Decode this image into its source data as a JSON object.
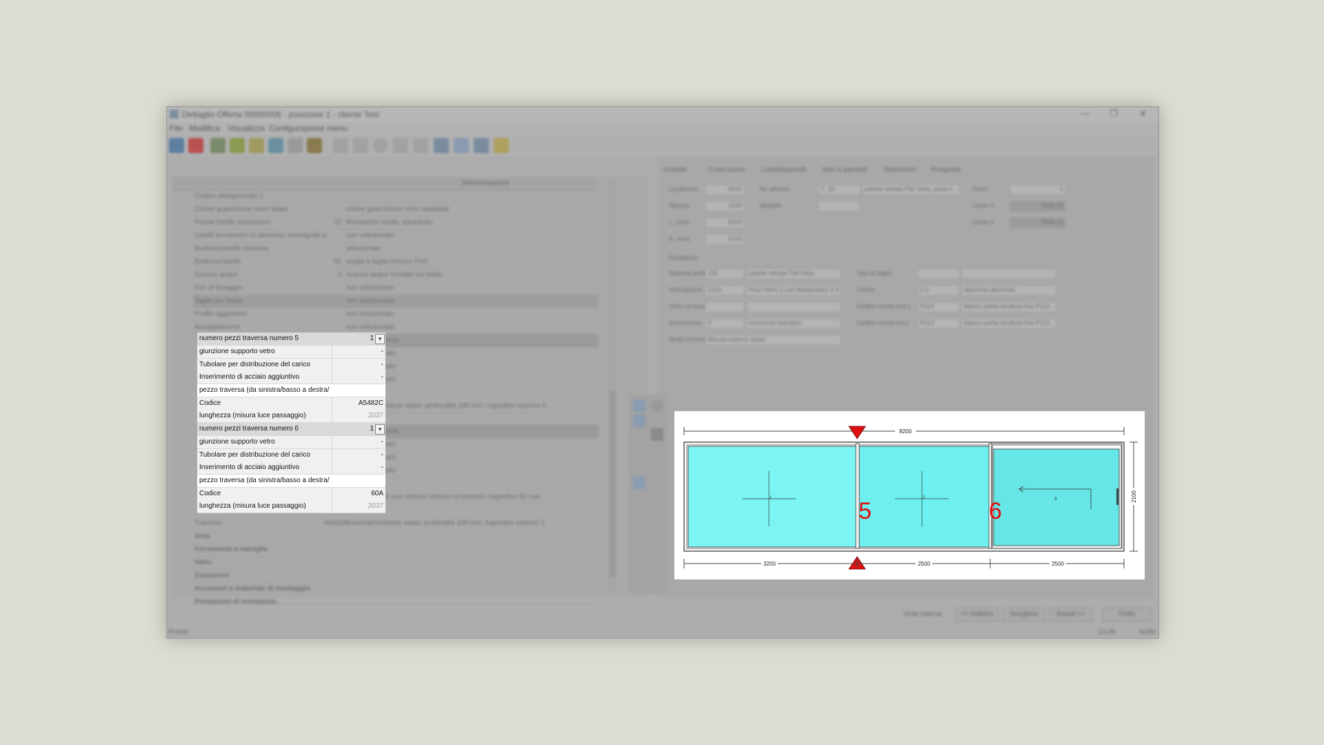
{
  "window": {
    "title": "Dettaglio Offerta 00000006 - posizione 1 - cliente Test",
    "menu": [
      "File",
      "Modifica",
      "Visualizza",
      "Configurazione menu"
    ]
  },
  "left_grid": {
    "header": "Denominazione",
    "background_rows": [
      {
        "name": "Codice allargamento 2",
        "value": "",
        "desc": ""
      },
      {
        "name": "Colore guarnizione vetro telaio",
        "value": "-",
        "desc": "colore guarnizione vetro standard"
      },
      {
        "name": "Forma listello fermavetro",
        "value": "10",
        "desc": "fermavetro tondo, squadrato"
      },
      {
        "name": "Listelli fermavetro in alluminio consegnati a",
        "value": "",
        "desc": "non selezionato"
      },
      {
        "name": "Bodenschwelle simulata",
        "value": "",
        "desc": "selezionato"
      },
      {
        "name": "Bodenschwelle",
        "value": "50",
        "desc": "soglia a taglio termico PVC"
      },
      {
        "name": "Scarico acque",
        "value": "0",
        "desc": "scarico acque frontale sul telaio"
      },
      {
        "name": "Fori di fissaggio",
        "value": "",
        "desc": "non selezionato"
      },
      {
        "name": "Taglio per telaio",
        "value": "",
        "desc": "non selezionato"
      },
      {
        "name": "Profilo aggiuntivo",
        "value": "",
        "desc": "non selezionato"
      },
      {
        "name": "Accoppiamenti",
        "value": "",
        "desc": "non selezionato"
      }
    ],
    "rows": [
      {
        "name": "numero pezzi traversa numero 5",
        "value": "1",
        "desc": "1 pezzo traversa",
        "type": "hdr",
        "dropdown": true
      },
      {
        "name": "giunzione supporto vetro",
        "value": "-",
        "desc": "non selezionato",
        "type": "l1"
      },
      {
        "name": "Tubolare per distribuzione del carico",
        "value": "-",
        "desc": "non selezionato",
        "type": "l1"
      },
      {
        "name": "Inserimento di acciaio aggiuntivo",
        "value": "-",
        "desc": "non selezionato",
        "type": "l1"
      },
      {
        "name": "pezzo traversa (da sinistra/basso a destra/",
        "value": "",
        "desc": "",
        "type": "white"
      },
      {
        "name": "Codice",
        "value": "A5482C",
        "desc": "traversa/montante telaio: profondità 100 mm; ingombro esterno 5",
        "type": "l1"
      },
      {
        "name": "lunghezza (misura luce passaggio)",
        "value": "2037",
        "desc": "",
        "type": "l1",
        "grey": true
      },
      {
        "name": "numero pezzi traversa numero 6",
        "value": "1",
        "desc": "1 pezzo traversa",
        "type": "hdr",
        "dropdown": true
      },
      {
        "name": "giunzione supporto vetro",
        "value": "-",
        "desc": "non selezionato",
        "type": "l1"
      },
      {
        "name": "Tubolare per distribuzione del carico",
        "value": "-",
        "desc": "non selezionato",
        "type": "l1"
      },
      {
        "name": "Inserimento di acciaio aggiuntivo",
        "value": "-",
        "desc": "non selezionato",
        "type": "l1"
      },
      {
        "name": "pezzo traversa (da sinistra/basso a destra/",
        "value": "",
        "desc": "",
        "type": "white"
      },
      {
        "name": "Codice",
        "value": "60A",
        "desc": "nodo centrale con rinforzo interno ed esterno: ingombro 82 mm",
        "type": "l1"
      },
      {
        "name": "lunghezza (misura luce passaggio)",
        "value": "2037",
        "desc": "",
        "type": "l1",
        "grey": true
      }
    ],
    "after_rows": [
      {
        "name": "Traversa",
        "value": "A5482C",
        "desc": "traversa/montante telaio: profondità 100 mm; ingombro esterno 5"
      },
      {
        "name": "Anta",
        "value": "",
        "desc": ""
      },
      {
        "name": "Ferramenta e maniglie",
        "value": "",
        "desc": ""
      },
      {
        "name": "Vetro",
        "value": "",
        "desc": ""
      },
      {
        "name": "Zanzariere",
        "value": "",
        "desc": ""
      },
      {
        "name": "Accessori e materiale di montaggio",
        "value": "",
        "desc": ""
      },
      {
        "name": "Prestazioni di montaggio",
        "value": "",
        "desc": ""
      }
    ]
  },
  "right_tabs": [
    "Globale",
    "Costruzione",
    "Listelli/pannelli",
    "Vetri e pannelli",
    "Restrizioni",
    "Prospetto"
  ],
  "fields": {
    "larghezza": {
      "label": "Larghezza",
      "value": "8200"
    },
    "altezza": {
      "label": "Altezza",
      "value": "2100"
    },
    "l_costr": {
      "label": "L. costr.",
      "value": "8200"
    },
    "a_costr": {
      "label": "A. costr.",
      "value": "2100"
    },
    "nr_articolo": {
      "label": "Nr. articolo",
      "value": "Y_00",
      "desc": "parete vetrata FW-Vista, porta s"
    },
    "modello": {
      "label": "Modello",
      "value": ""
    },
    "pezzi": {
      "label": "Pezzi",
      "value": "1"
    },
    "lordo_v": {
      "label": "Lordo-V",
      "value": "9999.20"
    },
    "lordo_a": {
      "label": "Lordo-A",
      "value": "9999.20"
    },
    "section": "Predefinito",
    "sistema": {
      "label": "Sistema profili",
      "value": "136",
      "desc": "parete vetrata FW-Vista"
    },
    "vetro": {
      "label": "Vetro/panne",
      "value": "2323",
      "desc": "Pluo-Vetro 2 con Multiprotect a 4"
    },
    "vetro_orn": {
      "label": "Vetro ornamentale",
      "value": "",
      "desc": ""
    },
    "esecuzione": {
      "label": "Esecuzione",
      "value": "0",
      "desc": "sicurezza standard"
    },
    "modo": {
      "label": "Modo d'immissione",
      "value": "Misura esterno telaio"
    },
    "tipo_taglio": {
      "label": "Tipo di taglio",
      "value": ""
    },
    "colore": {
      "label": "Colore",
      "value": "2-2",
      "desc": "alluminio-alluminio"
    },
    "codice_est": {
      "label": "Codice colore (est.)",
      "value": "P113",
      "desc": "bianco perla struttura fine P113"
    },
    "codice_int": {
      "label": "Codice colore (int.)",
      "value": "P113",
      "desc": "bianco perla struttura fine P113"
    }
  },
  "bottom_buttons": [
    "Vista interna",
    "<< Indietro",
    "Scegliere",
    "Avanti >>",
    "Finito"
  ],
  "status": {
    "left": "Pronto",
    "time": "13:39",
    "mode": "NUM"
  },
  "drawing": {
    "overall_width": "8200",
    "height": "2100",
    "segments": [
      "3200",
      "2500",
      "2500"
    ],
    "panels": [
      "1",
      "2",
      "3"
    ],
    "transom_labels": [
      "5",
      "6"
    ],
    "glass_color": "#7df4f4",
    "marker_color": "#e01010"
  }
}
